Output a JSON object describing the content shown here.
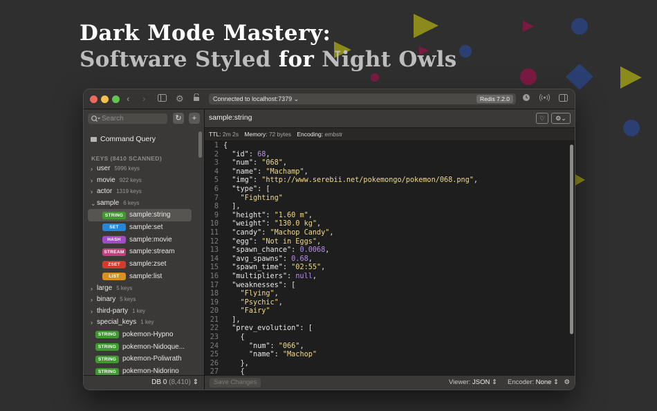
{
  "hero": {
    "line1": "Dark Mode Mastery:",
    "line2_a": "Software Styled",
    "line2_b": "for",
    "line2_c": "Night Owls"
  },
  "colors": {
    "background": "#2f2f2f",
    "deco_olive": "#8d8a1c",
    "deco_magenta": "#8a1a4a",
    "deco_blue": "#2b3f73",
    "badge_string": "#3e9a2c",
    "badge_set": "#2a86d3",
    "badge_hash": "#a14bc4",
    "badge_stream": "#c0417c",
    "badge_zset": "#cf3b2e",
    "badge_list": "#d9901c",
    "syntax_string": "#f0d98a",
    "syntax_number": "#b78ee6"
  },
  "titlebar": {
    "connection_prefix": "Connected to",
    "connection_host": "localhost:7379",
    "version": "Redis 7.2.0",
    "icons": [
      "back-icon",
      "forward-icon",
      "sidebar-toggle-icon",
      "gear-icon",
      "lock-icon",
      "history-icon",
      "broadcast-icon",
      "inspector-toggle-icon"
    ]
  },
  "sidebar": {
    "search_placeholder": "Search",
    "command_query": "Command Query",
    "keys_header": "KEYS (8410 SCANNED)",
    "groups_top": [
      {
        "name": "user",
        "count": "5996 keys"
      },
      {
        "name": "movie",
        "count": "922 keys"
      },
      {
        "name": "actor",
        "count": "1319 keys"
      },
      {
        "name": "sample",
        "count": "6 keys"
      }
    ],
    "sample_children": [
      {
        "type": "STRING",
        "name": "sample:string"
      },
      {
        "type": "SET",
        "name": "sample:set"
      },
      {
        "type": "HASH",
        "name": "sample:movie"
      },
      {
        "type": "STREAM",
        "name": "sample:stream"
      },
      {
        "type": "ZSET",
        "name": "sample:zset"
      },
      {
        "type": "LIST",
        "name": "sample:list"
      }
    ],
    "groups_bottom": [
      {
        "name": "large",
        "count": "5 keys"
      },
      {
        "name": "binary",
        "count": "5 keys"
      },
      {
        "name": "third-party",
        "count": "1 key"
      },
      {
        "name": "special_keys",
        "count": "1 key"
      }
    ],
    "root_keys": [
      {
        "type": "STRING",
        "name": "pokemon-Hypno"
      },
      {
        "type": "STRING",
        "name": "pokemon-Nidoque..."
      },
      {
        "type": "STRING",
        "name": "pokemon-Poliwrath"
      },
      {
        "type": "STRING",
        "name": "pokemon-Nidorino"
      }
    ],
    "db_label": "DB 0",
    "db_count": "(8,410)"
  },
  "main": {
    "key_title": "sample:string",
    "ttl_label": "TTL:",
    "ttl_value": "2m 2s",
    "memory_label": "Memory:",
    "memory_value": "72 bytes",
    "encoding_label": "Encoding:",
    "encoding_value": "embstr",
    "code_lines": [
      [
        [
          "p",
          "{"
        ]
      ],
      [
        [
          "p",
          "  "
        ],
        [
          "k",
          "\"id\""
        ],
        [
          "p",
          ": "
        ],
        [
          "n",
          "68"
        ],
        [
          "p",
          ","
        ]
      ],
      [
        [
          "p",
          "  "
        ],
        [
          "k",
          "\"num\""
        ],
        [
          "p",
          ": "
        ],
        [
          "s",
          "\"068\""
        ],
        [
          "p",
          ","
        ]
      ],
      [
        [
          "p",
          "  "
        ],
        [
          "k",
          "\"name\""
        ],
        [
          "p",
          ": "
        ],
        [
          "s",
          "\"Machamp\""
        ],
        [
          "p",
          ","
        ]
      ],
      [
        [
          "p",
          "  "
        ],
        [
          "k",
          "\"img\""
        ],
        [
          "p",
          ": "
        ],
        [
          "s",
          "\"http://www.serebii.net/pokemongo/pokemon/068.png\""
        ],
        [
          "p",
          ","
        ]
      ],
      [
        [
          "p",
          "  "
        ],
        [
          "k",
          "\"type\""
        ],
        [
          "p",
          ": ["
        ]
      ],
      [
        [
          "p",
          "    "
        ],
        [
          "s",
          "\"Fighting\""
        ]
      ],
      [
        [
          "p",
          "  ],"
        ]
      ],
      [
        [
          "p",
          "  "
        ],
        [
          "k",
          "\"height\""
        ],
        [
          "p",
          ": "
        ],
        [
          "s",
          "\"1.60 m\""
        ],
        [
          "p",
          ","
        ]
      ],
      [
        [
          "p",
          "  "
        ],
        [
          "k",
          "\"weight\""
        ],
        [
          "p",
          ": "
        ],
        [
          "s",
          "\"130.0 kg\""
        ],
        [
          "p",
          ","
        ]
      ],
      [
        [
          "p",
          "  "
        ],
        [
          "k",
          "\"candy\""
        ],
        [
          "p",
          ": "
        ],
        [
          "s",
          "\"Machop Candy\""
        ],
        [
          "p",
          ","
        ]
      ],
      [
        [
          "p",
          "  "
        ],
        [
          "k",
          "\"egg\""
        ],
        [
          "p",
          ": "
        ],
        [
          "s",
          "\"Not in Eggs\""
        ],
        [
          "p",
          ","
        ]
      ],
      [
        [
          "p",
          "  "
        ],
        [
          "k",
          "\"spawn_chance\""
        ],
        [
          "p",
          ": "
        ],
        [
          "n",
          "0.0068"
        ],
        [
          "p",
          ","
        ]
      ],
      [
        [
          "p",
          "  "
        ],
        [
          "k",
          "\"avg_spawns\""
        ],
        [
          "p",
          ": "
        ],
        [
          "n",
          "0.68"
        ],
        [
          "p",
          ","
        ]
      ],
      [
        [
          "p",
          "  "
        ],
        [
          "k",
          "\"spawn_time\""
        ],
        [
          "p",
          ": "
        ],
        [
          "s",
          "\"02:55\""
        ],
        [
          "p",
          ","
        ]
      ],
      [
        [
          "p",
          "  "
        ],
        [
          "k",
          "\"multipliers\""
        ],
        [
          "p",
          ": "
        ],
        [
          "n",
          "null"
        ],
        [
          "p",
          ","
        ]
      ],
      [
        [
          "p",
          "  "
        ],
        [
          "k",
          "\"weaknesses\""
        ],
        [
          "p",
          ": ["
        ]
      ],
      [
        [
          "p",
          "    "
        ],
        [
          "s",
          "\"Flying\""
        ],
        [
          "p",
          ","
        ]
      ],
      [
        [
          "p",
          "    "
        ],
        [
          "s",
          "\"Psychic\""
        ],
        [
          "p",
          ","
        ]
      ],
      [
        [
          "p",
          "    "
        ],
        [
          "s",
          "\"Fairy\""
        ]
      ],
      [
        [
          "p",
          "  ],"
        ]
      ],
      [
        [
          "p",
          "  "
        ],
        [
          "k",
          "\"prev_evolution\""
        ],
        [
          "p",
          ": ["
        ]
      ],
      [
        [
          "p",
          "    {"
        ]
      ],
      [
        [
          "p",
          "      "
        ],
        [
          "k",
          "\"num\""
        ],
        [
          "p",
          ": "
        ],
        [
          "s",
          "\"066\""
        ],
        [
          "p",
          ","
        ]
      ],
      [
        [
          "p",
          "      "
        ],
        [
          "k",
          "\"name\""
        ],
        [
          "p",
          ": "
        ],
        [
          "s",
          "\"Machop\""
        ]
      ],
      [
        [
          "p",
          "    },"
        ]
      ],
      [
        [
          "p",
          "    {"
        ]
      ]
    ],
    "save_label": "Save Changes",
    "viewer_label": "Viewer:",
    "viewer_value": "JSON",
    "encoder_label": "Encoder:",
    "encoder_value": "None"
  }
}
